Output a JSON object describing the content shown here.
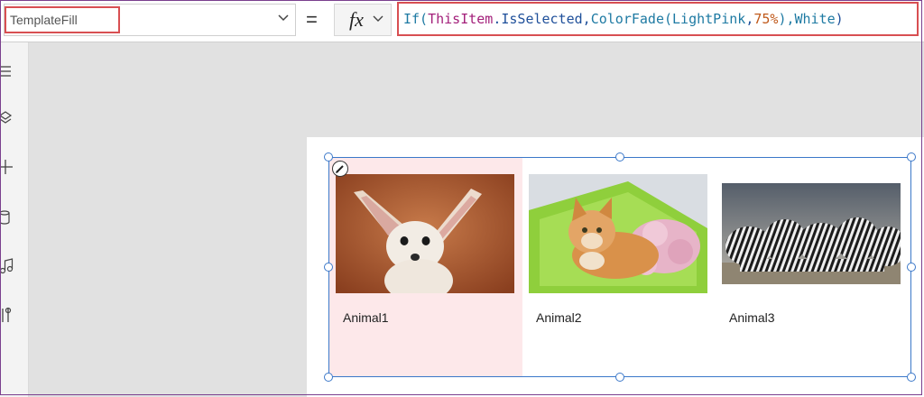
{
  "formula_bar": {
    "property": "TemplateFill",
    "equals": "=",
    "fx": "fx",
    "formula_tokens": [
      {
        "text": "If(",
        "kind": "tk-fn"
      },
      {
        "text": "ThisItem",
        "kind": "tk-kw"
      },
      {
        "text": ".IsSelected,",
        "kind": "tk-prop"
      },
      {
        "text": "ColorFade(",
        "kind": "tk-fn"
      },
      {
        "text": "LightPink",
        "kind": "tk-fn"
      },
      {
        "text": ",",
        "kind": "tk-prop"
      },
      {
        "text": "75%",
        "kind": "tk-num"
      },
      {
        "text": "),",
        "kind": "tk-fn"
      },
      {
        "text": "White",
        "kind": "tk-fn"
      },
      {
        "text": ")",
        "kind": "tk-prop"
      }
    ]
  },
  "rail_icons": [
    "hamburger-icon",
    "layers-icon",
    "plus-icon",
    "database-icon",
    "media-icon",
    "tools-icon"
  ],
  "gallery": {
    "selected_fill": "#fde8ea",
    "items": [
      {
        "label": "Animal1",
        "image": "fennec-fox-photo",
        "selected": true
      },
      {
        "label": "Animal2",
        "image": "cat-photo",
        "selected": false
      },
      {
        "label": "Animal3",
        "image": "zebra-herd-photo",
        "selected": false
      }
    ]
  },
  "colors": {
    "highlight_border": "#d84f52",
    "selection_blue": "#3b78c9"
  }
}
